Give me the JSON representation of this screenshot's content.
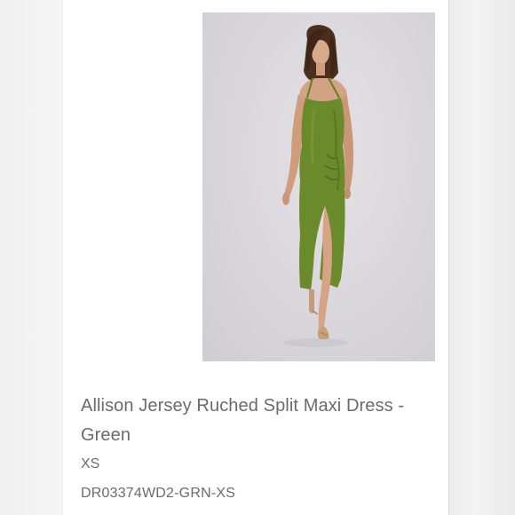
{
  "product": {
    "title": "Allison Jersey Ruched Split Maxi Dress - Green",
    "size": "XS",
    "sku": "DR03374WD2-GRN-XS",
    "dress_color": "#6b8a2c",
    "background_color": "#dad8dc"
  }
}
